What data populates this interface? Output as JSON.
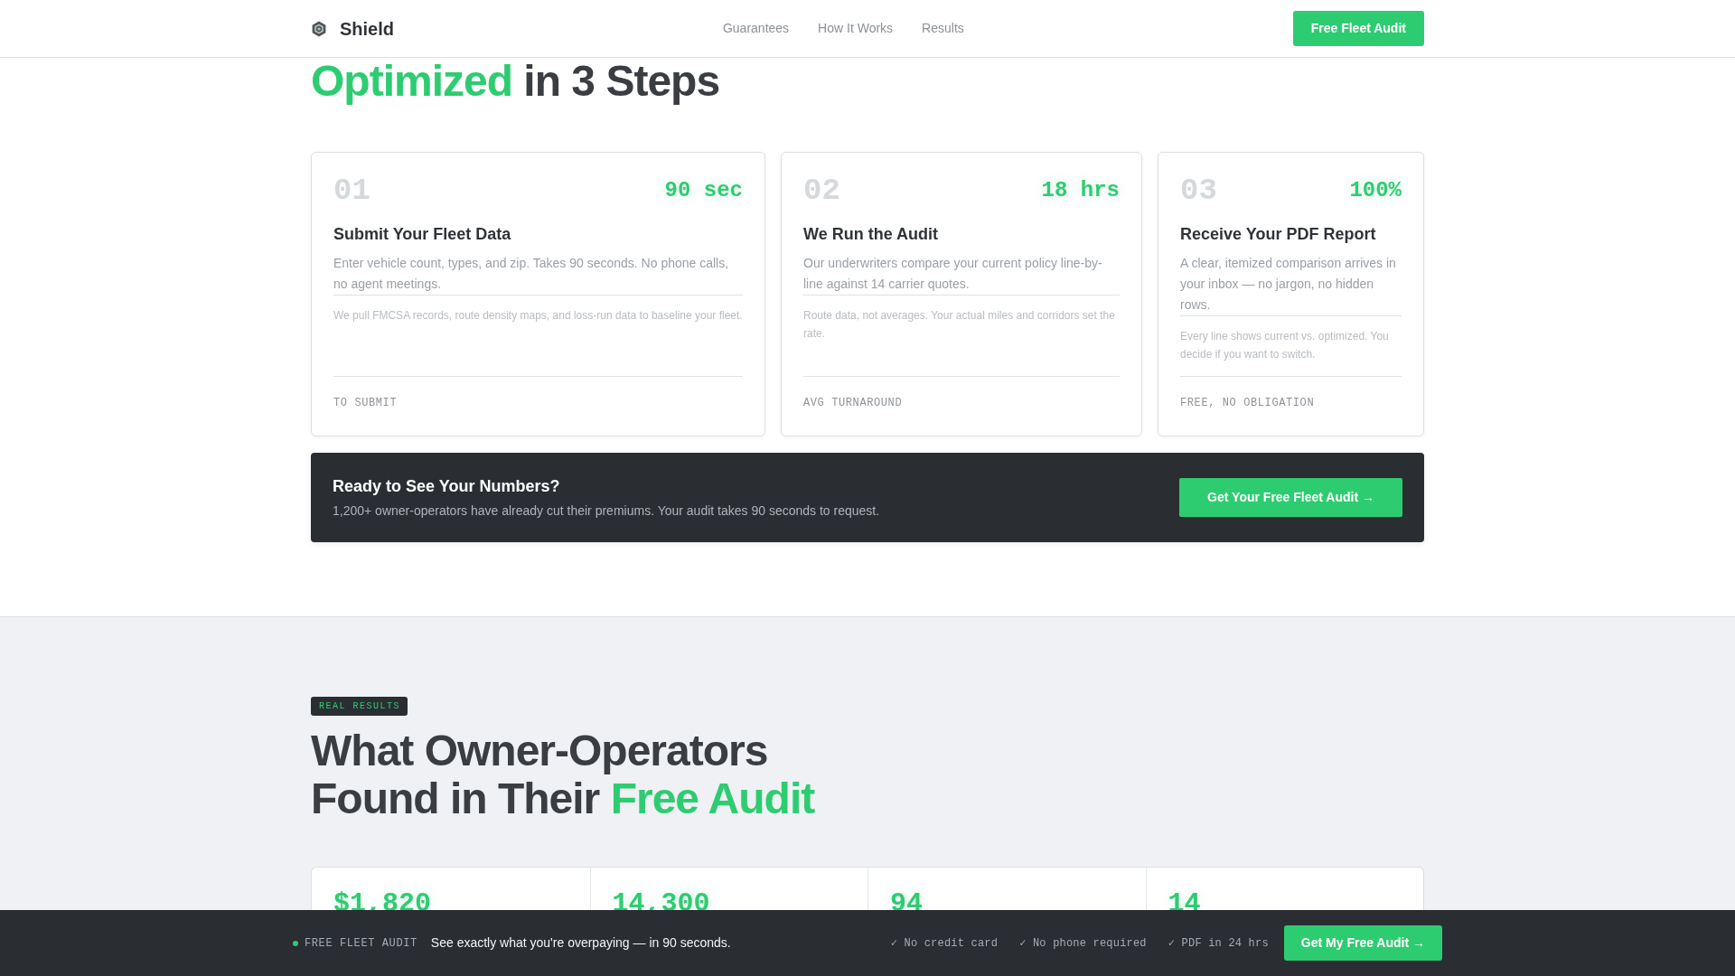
{
  "nav": {
    "brand": "Shield",
    "links": [
      {
        "label": "Guarantees"
      },
      {
        "label": "How It Works"
      },
      {
        "label": "Results"
      }
    ],
    "button": "Free Fleet Audit"
  },
  "steps_section": {
    "heading": [
      {
        "text": "Optimized",
        "highlight": true
      },
      {
        "text": "in 3 Steps",
        "highlight": false
      }
    ],
    "steps": [
      {
        "number": "01",
        "stat": "90 sec",
        "title": "Submit Your Fleet Data",
        "description": "Enter vehicle count, types, and zip. Takes 90 seconds. No phone calls, no agent meetings.",
        "note": "We pull FMCSA records, route density maps, and loss-run data to baseline your fleet.",
        "label": "TO SUBMIT"
      },
      {
        "number": "02",
        "stat": "18 hrs",
        "title": "We Run the Audit",
        "description": "Our underwriters compare your current policy line-by-line against 14 carrier quotes.",
        "note": "Route data, not averages. Your actual miles and corridors set the rate.",
        "label": "AVG TURNAROUND"
      },
      {
        "number": "03",
        "stat": "100%",
        "title": "Receive Your PDF Report",
        "description": "A clear, itemized comparison arrives in your inbox — no jargon, no hidden rows.",
        "note": "Every line shows current vs. optimized. You decide if you want to switch.",
        "label": "FREE, NO OBLIGATION"
      }
    ],
    "cta_banner": {
      "title": "Ready to See Your Numbers?",
      "text": "1,200+ owner-operators have already cut their premiums. Your audit takes 90 seconds to request.",
      "button": "Get Your Free Fleet Audit →"
    }
  },
  "results_section": {
    "badge": "REAL RESULTS",
    "heading": [
      {
        "text": "What Owner-Operators Found in Their",
        "highlight": false
      },
      {
        "text": "Free Audit",
        "highlight": true
      }
    ],
    "stats": [
      {
        "value": "$1,820"
      },
      {
        "value": "14,300"
      },
      {
        "value": "94"
      },
      {
        "value": "14"
      }
    ]
  },
  "bottom_bar": {
    "tag": "FREE FLEET AUDIT",
    "message": "See exactly what you're overpaying — in 90 seconds.",
    "perks": [
      "✓ No credit card",
      "✓ No phone required",
      "✓ PDF in 24 hrs"
    ],
    "button": "Get My Free Audit →"
  }
}
